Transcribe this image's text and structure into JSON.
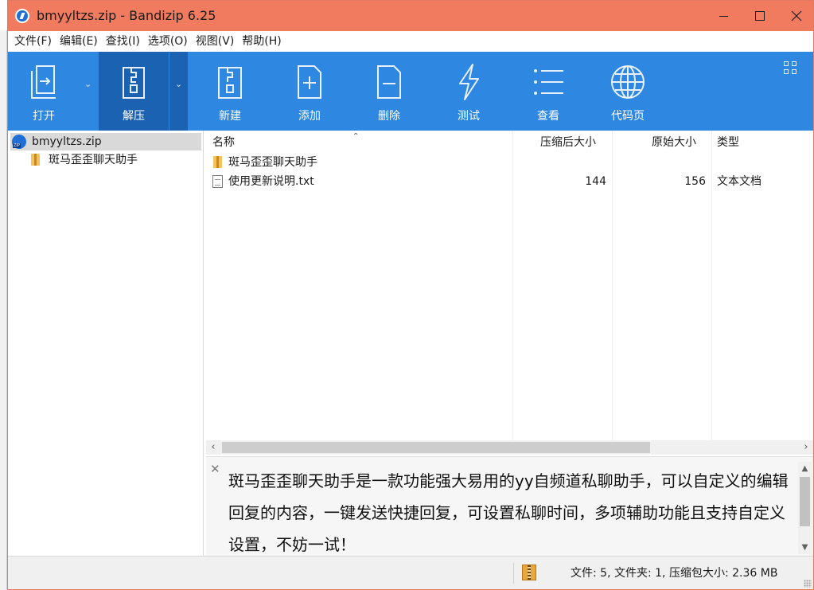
{
  "window": {
    "title": "bmyyltzs.zip - Bandizip 6.25",
    "accent": "#f07b5f"
  },
  "menu": [
    "文件(F)",
    "编辑(E)",
    "查找(I)",
    "选项(O)",
    "视图(V)",
    "帮助(H)"
  ],
  "toolbar": {
    "open": "打开",
    "extract": "解压",
    "new": "新建",
    "add": "添加",
    "delete": "删除",
    "test": "测试",
    "view": "查看",
    "codepage": "代码页",
    "color": "#2e87e0"
  },
  "tree": {
    "root": "bmyyltzs.zip",
    "child": "斑马歪歪聊天助手"
  },
  "list": {
    "columns": {
      "name": "名称",
      "compressed": "压缩后大小",
      "original": "原始大小",
      "type": "类型"
    },
    "rows": [
      {
        "name": "斑马歪歪聊天助手",
        "compressed": "",
        "original": "",
        "type": "",
        "icon": "folder-icon"
      },
      {
        "name": "使用更新说明.txt",
        "compressed": "144",
        "original": "156",
        "type": "文本文档",
        "icon": "text-file-icon"
      }
    ]
  },
  "description": {
    "text": "斑马歪歪聊天助手是一款功能强大易用的yy自频道私聊助手，可以自定义的编辑回复的内容，一键发送快捷回复，可设置私聊时间，多项辅助功能且支持自定义设置，不妨一试！"
  },
  "status": {
    "summary": "文件: 5, 文件夹: 1, 压缩包大小: 2.36 MB"
  }
}
